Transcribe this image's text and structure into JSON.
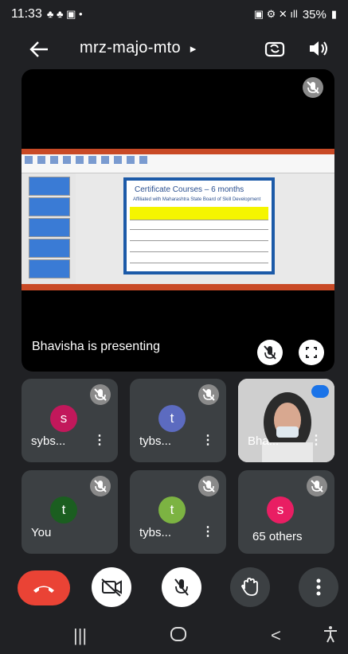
{
  "status_bar": {
    "time": "11:33",
    "battery": "35%"
  },
  "header": {
    "meeting_code": "mrz-majo-mto",
    "chevron": "▸"
  },
  "presentation": {
    "presenter_label": "Bhavisha is presenting",
    "slide_title": "Certificate Courses – 6 months",
    "slide_subtitle": "Affiliated with Maharashtra State Board of Skill Development"
  },
  "participants": [
    {
      "name": "sybs...",
      "initial": "s",
      "color": "#c2185b"
    },
    {
      "name": "tybs...",
      "initial": "t",
      "color": "#5c6bc0"
    },
    {
      "name": "Bha...",
      "initial": "",
      "color": "#cccccc"
    },
    {
      "name": "You",
      "initial": "t",
      "color": "#1b5e20"
    },
    {
      "name": "tybs...",
      "initial": "t",
      "color": "#7cb342"
    },
    {
      "name": "65 others",
      "initial": "s",
      "color": "#e91e63"
    }
  ],
  "colors": {
    "end_call": "#ea4335",
    "accent_blue": "#1a73e8"
  },
  "icons": {
    "back": "arrow-left-icon",
    "switch_camera": "switch-camera-icon",
    "speaker": "speaker-icon",
    "mic_off": "mic-off-icon",
    "fullscreen": "fullscreen-icon",
    "camera_off": "camera-off-icon",
    "raise_hand": "hand-icon",
    "more": "more-vert-icon",
    "end_call": "call-end-icon"
  }
}
